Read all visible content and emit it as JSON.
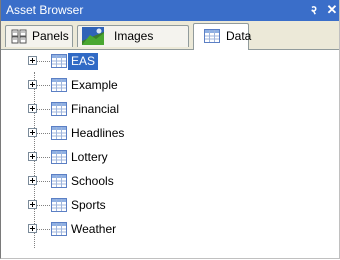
{
  "window": {
    "title": "Asset Browser",
    "pin_icon": "pin-icon",
    "close_icon": "close-icon",
    "pin_glyph": "२",
    "close_glyph": "✕"
  },
  "tabs": [
    {
      "label": "Panels",
      "icon": "panels-icon",
      "active": false
    },
    {
      "label": "Images",
      "icon": "images-icon",
      "active": false
    },
    {
      "label": "Data",
      "icon": "data-table-icon",
      "active": true
    }
  ],
  "tree": {
    "items": [
      {
        "label": "EAS",
        "icon": "data-table-icon",
        "expandable": true,
        "selected": true
      },
      {
        "label": "Example",
        "icon": "data-table-icon",
        "expandable": true,
        "selected": false
      },
      {
        "label": "Financial",
        "icon": "data-table-icon",
        "expandable": true,
        "selected": false
      },
      {
        "label": "Headlines",
        "icon": "data-table-icon",
        "expandable": true,
        "selected": false
      },
      {
        "label": "Lottery",
        "icon": "data-table-icon",
        "expandable": true,
        "selected": false
      },
      {
        "label": "Schools",
        "icon": "data-table-icon",
        "expandable": true,
        "selected": false
      },
      {
        "label": "Sports",
        "icon": "data-table-icon",
        "expandable": true,
        "selected": false
      },
      {
        "label": "Weather",
        "icon": "data-table-icon",
        "expandable": true,
        "selected": false
      }
    ]
  },
  "colors": {
    "title_bar": "#3a6ec9",
    "selection": "#316ac5",
    "tab_strip": "#ece9d8",
    "table_icon_blue": "#5b7fc4"
  }
}
